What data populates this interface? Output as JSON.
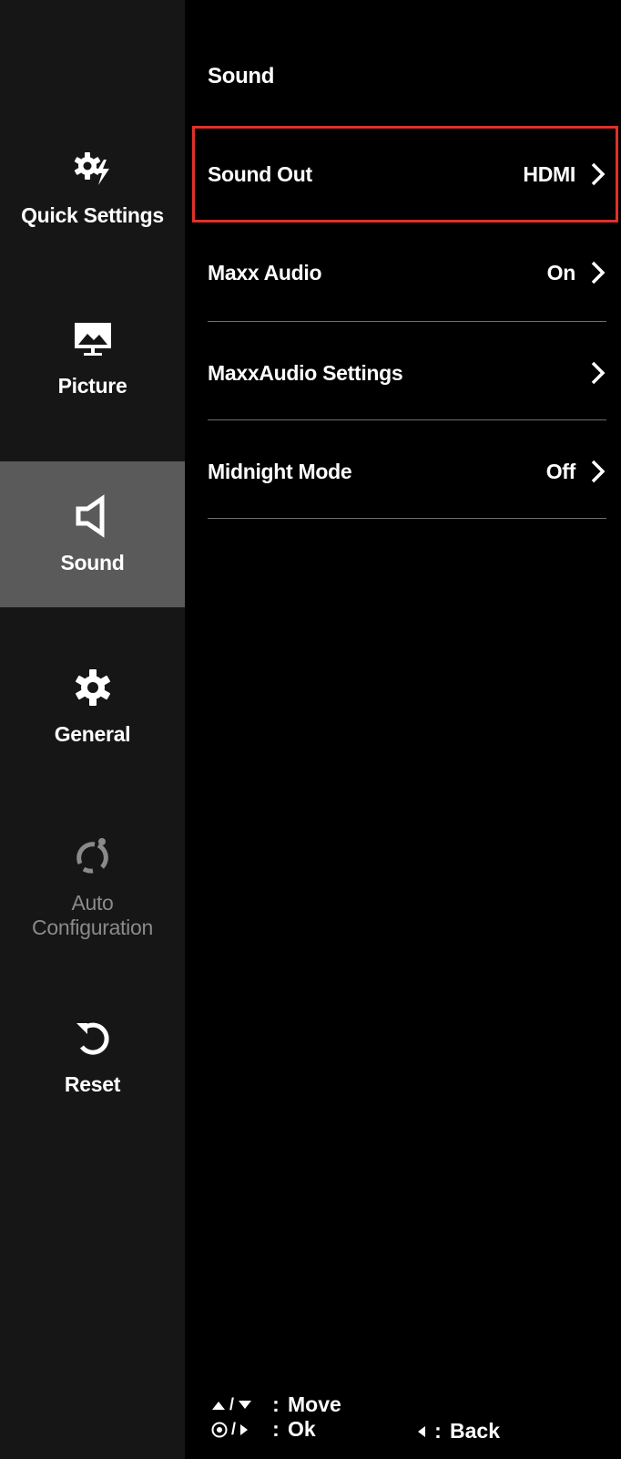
{
  "sidebar": {
    "items": [
      {
        "label": "Quick Settings",
        "icon": "gear-bolt-icon",
        "state": "normal"
      },
      {
        "label": "Picture",
        "icon": "monitor-picture-icon",
        "state": "normal"
      },
      {
        "label": "Sound",
        "icon": "speaker-icon",
        "state": "active"
      },
      {
        "label": "General",
        "icon": "gear-icon",
        "state": "normal"
      },
      {
        "label": "Auto Configuration",
        "icon": "auto-config-icon",
        "state": "disabled"
      },
      {
        "label": "Reset",
        "icon": "reset-icon",
        "state": "normal"
      }
    ]
  },
  "main": {
    "title": "Sound",
    "rows": [
      {
        "label": "Sound Out",
        "value": "HDMI",
        "selected": true
      },
      {
        "label": "Maxx Audio",
        "value": "On"
      },
      {
        "label": "MaxxAudio Settings",
        "value": ""
      },
      {
        "label": "Midnight Mode",
        "value": "Off"
      }
    ]
  },
  "footer": {
    "move_label": "Move",
    "ok_label": "Ok",
    "back_label": "Back",
    "move_sep": "/",
    "ok_sep": "/",
    "colon": ":"
  },
  "colors": {
    "sidebar_bg": "#161616",
    "active_item_bg": "#5a5a5a",
    "selection_border": "#e0312a",
    "disabled_text": "#8a8a8a"
  }
}
